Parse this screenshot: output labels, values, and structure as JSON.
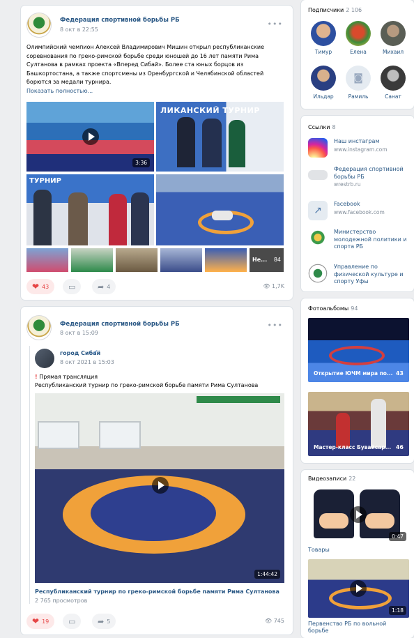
{
  "colors": {
    "link": "#2a5885",
    "muted": "#818c99",
    "like": "#e64646",
    "bg": "#edeef0",
    "instagram": "#e1306c",
    "facebook": "#4a76a8"
  },
  "post1": {
    "author": "Федерация спортивной борьбы РБ",
    "date": "8 окт в 22:55",
    "text": "Олимпийский чемпион Алексей Владимирович Мишин открыл республиканские соревнования по греко-римской борьбе среди юношей до 16 лет памяти Рима Султанова в рамках проекта «Вперед Сибай». Более ста юных борцов из Башкортостана, а также спортсмены из Оренбургской и Челябинской областей борются за медали турнира.",
    "show_more": "Показать полностью...",
    "video_duration": "3:36",
    "banner_text": "ЛИКАНСКИЙ ТУРНИР",
    "banner_text2": "ТУРНИР",
    "thumb_more_label": "Не...",
    "thumb_more_count": "84",
    "likes": "43",
    "shares": "4",
    "views": "1,7K"
  },
  "post2": {
    "author": "Федерация спортивной борьбы РБ",
    "date": "8 окт в 15:09",
    "repost_author": "город Сибай",
    "repost_date": "8 окт 2021 в 15:03",
    "live_label": "Прямая трансляция",
    "live_title": "Республиканский турнир по греко-римской борьбе памяти Рима Султанова",
    "video_duration": "1:44:42",
    "video_title": "Республиканский турнир по греко-римской борьбе памяти Рима Султанова",
    "video_views": "2 765 просмотров",
    "likes": "19",
    "shares": "5",
    "views": "745"
  },
  "sidebar": {
    "subscribers_title": "Подписчики",
    "subscribers_count": "2 106",
    "subscribers": [
      {
        "name": "Тимур"
      },
      {
        "name": "Елена"
      },
      {
        "name": "Михаил"
      },
      {
        "name": "Ильдар"
      },
      {
        "name": "Рамиль"
      },
      {
        "name": "Санат"
      }
    ],
    "links_title": "Ссылки",
    "links_count": "8",
    "links": [
      {
        "title": "Наш инстаграм",
        "url": "www.instagram.com",
        "icon": "instagram-icon"
      },
      {
        "title": "Федерация спортивной борьбы РБ",
        "url": "wrestrb.ru",
        "icon": "site-icon"
      },
      {
        "title": "Facebook",
        "url": "www.facebook.com",
        "icon": "facebook-icon"
      },
      {
        "title": "Министерство молодежной политики и спорта РБ",
        "url": "",
        "icon": "emblem-icon"
      },
      {
        "title": "Управление по физической культуре и спорту Уфы",
        "url": "",
        "icon": "emblem-icon"
      }
    ],
    "albums_title": "Фотоальбомы",
    "albums_count": "94",
    "albums": [
      {
        "caption": "Открытие ЮЧМ мира по...",
        "count": "43"
      },
      {
        "caption": "Мастер-класс Бувайсар...",
        "count": "46"
      }
    ],
    "videos_title": "Видеозаписи",
    "videos_count": "22",
    "videos": [
      {
        "duration": "0:47",
        "title": "Товары"
      },
      {
        "duration": "1:18",
        "title": "Первенство РБ по вольной борьбе"
      }
    ]
  }
}
